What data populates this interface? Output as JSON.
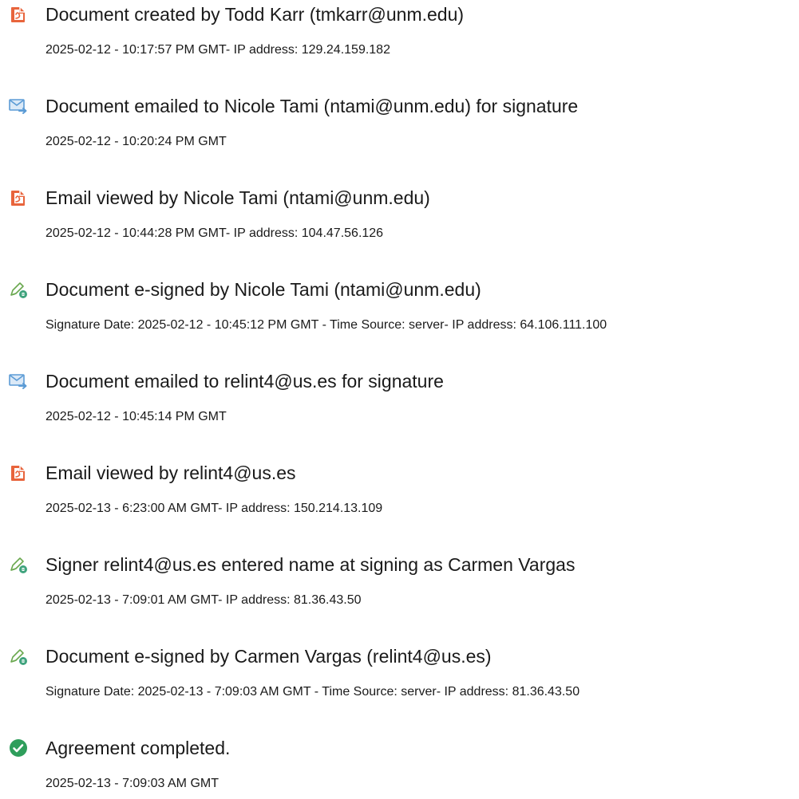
{
  "events": [
    {
      "icon": "document-created-icon",
      "title": "Document created by Todd Karr (tmkarr@unm.edu)",
      "detail": "2025-02-12 - 10:17:57 PM GMT- IP address: 129.24.159.182"
    },
    {
      "icon": "email-sent-icon",
      "title": "Document emailed to Nicole Tami (ntami@unm.edu) for signature",
      "detail": "2025-02-12 - 10:20:24 PM GMT"
    },
    {
      "icon": "email-viewed-icon",
      "title": "Email viewed by Nicole Tami (ntami@unm.edu)",
      "detail": "2025-02-12 - 10:44:28 PM GMT- IP address: 104.47.56.126"
    },
    {
      "icon": "e-signed-icon",
      "title": "Document e-signed by Nicole Tami (ntami@unm.edu)",
      "detail": "Signature Date: 2025-02-12 - 10:45:12 PM GMT - Time Source: server- IP address: 64.106.111.100"
    },
    {
      "icon": "email-sent-icon",
      "title": "Document emailed to relint4@us.es for signature",
      "detail": "2025-02-12 - 10:45:14 PM GMT"
    },
    {
      "icon": "email-viewed-icon",
      "title": "Email viewed by relint4@us.es",
      "detail": "2025-02-13 - 6:23:00 AM GMT- IP address: 150.214.13.109"
    },
    {
      "icon": "e-signed-icon",
      "title": "Signer relint4@us.es entered name at signing as Carmen Vargas",
      "detail": "2025-02-13 - 7:09:01 AM GMT- IP address: 81.36.43.50"
    },
    {
      "icon": "e-signed-icon",
      "title": "Document e-signed by Carmen Vargas (relint4@us.es)",
      "detail": "Signature Date: 2025-02-13 - 7:09:03 AM GMT - Time Source: server- IP address: 81.36.43.50"
    },
    {
      "icon": "agreement-completed-icon",
      "title": "Agreement completed.",
      "detail": "2025-02-13 - 7:09:03 AM GMT"
    }
  ],
  "colors": {
    "document_icon": "#e8643c",
    "email_icon": "#5b9bd5",
    "sign_icon": "#3fa37d",
    "completed_icon": "#2e9e5b"
  }
}
